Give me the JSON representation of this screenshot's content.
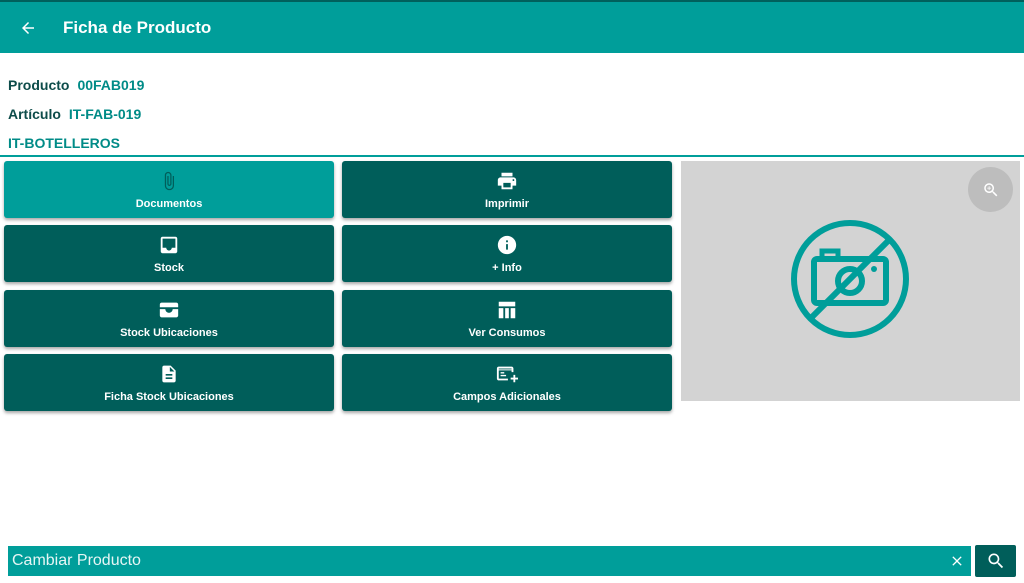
{
  "header": {
    "title": "Ficha de Producto",
    "back_icon": "arrow-left-icon"
  },
  "product": {
    "product_label": "Producto",
    "product_value": "00FAB019",
    "article_label": "Artículo",
    "article_value": "IT-FAB-019",
    "description": "IT-BOTELLEROS"
  },
  "actions": [
    {
      "label": "Documentos",
      "icon": "paperclip-icon",
      "active": true
    },
    {
      "label": "Imprimir",
      "icon": "printer-icon"
    },
    {
      "label": "Stock",
      "icon": "inbox-icon"
    },
    {
      "label": "+ Info",
      "icon": "info-icon"
    },
    {
      "label": "Stock Ubicaciones",
      "icon": "inbox-stack-icon"
    },
    {
      "label": "Ver Consumos",
      "icon": "table-icon"
    },
    {
      "label": "Ficha Stock Ubicaciones",
      "icon": "document-icon"
    },
    {
      "label": "Campos Adicionales",
      "icon": "add-card-icon"
    }
  ],
  "image_panel": {
    "zoom_icon": "zoom-in-icon",
    "placeholder_icon": "no-photo-icon"
  },
  "search": {
    "placeholder": "Cambiar Producto",
    "value": "",
    "clear_icon": "close-icon",
    "search_icon": "search-icon"
  },
  "colors": {
    "primary": "#009e9a",
    "primary_dark": "#005e5a",
    "label_text": "#0d4c4a",
    "panel_bg": "#d3d3d3"
  }
}
